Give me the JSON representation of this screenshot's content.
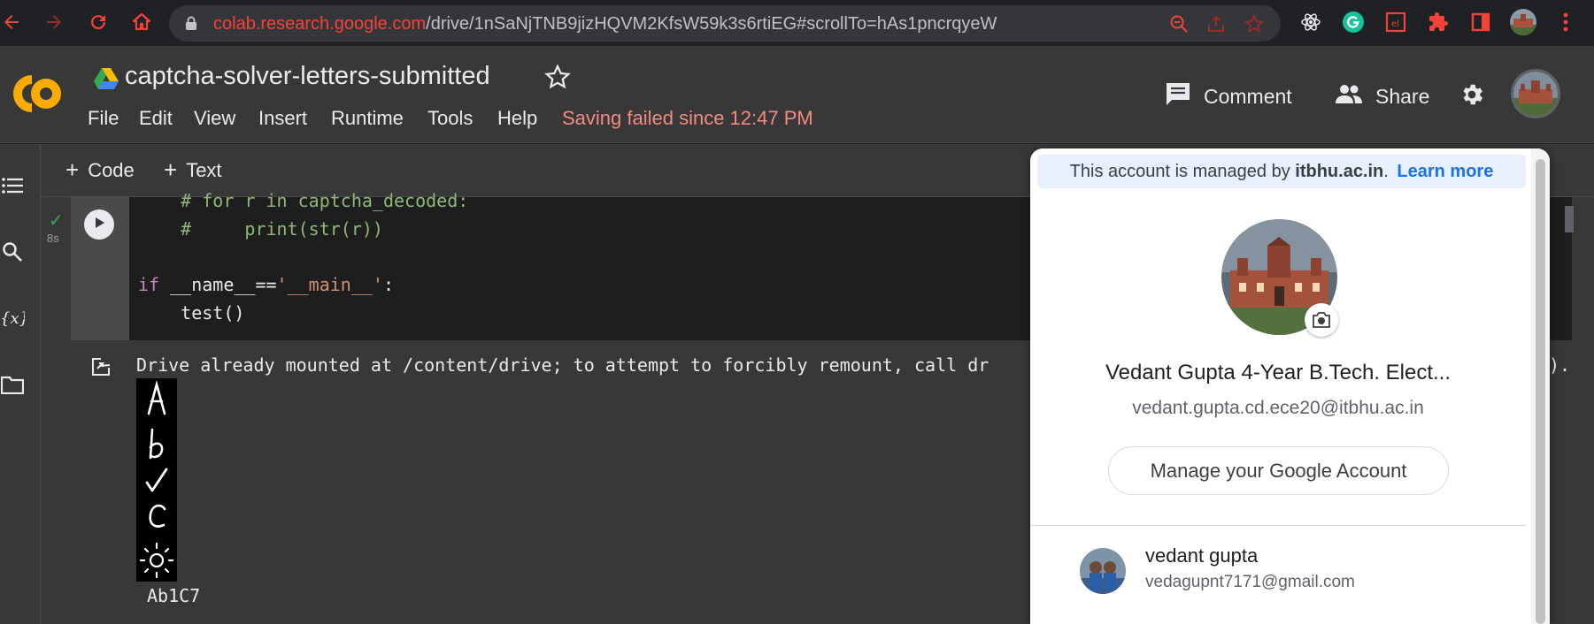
{
  "browser": {
    "url_host": "colab.research.google.com",
    "url_path": "/drive/1nSaNjTNB9jizHQVM2KfsW59k3s6rtiEG#scrollTo=hAs1pncrqyeW"
  },
  "header": {
    "title": "captcha-solver-letters-submitted",
    "menu": [
      "File",
      "Edit",
      "View",
      "Insert",
      "Runtime",
      "Tools",
      "Help"
    ],
    "saving_status": "Saving failed since 12:47 PM",
    "comment_label": "Comment",
    "share_label": "Share"
  },
  "toolbar": {
    "code_label": "Code",
    "text_label": "Text"
  },
  "cell": {
    "exec_time": "8s",
    "code_lines": [
      "    # for r in captcha_decoded:",
      "    #     print(str(r))",
      "",
      "if __name__=='__main__':",
      "    test()"
    ],
    "output_text": "Drive already mounted at /content/drive; to attempt to forcibly remount, call dr",
    "output_tail": ").",
    "captcha_label": "Ab1C7"
  },
  "account_popup": {
    "managed_prefix": "This account is managed by",
    "managed_domain": "itbhu.ac.in",
    "learn_more": "Learn more",
    "name": "Vedant Gupta 4-Year B.Tech. Elect...",
    "email": "vedant.gupta.cd.ece20@itbhu.ac.in",
    "manage_button": "Manage your Google Account",
    "other_account": {
      "name": "vedant gupta",
      "email": "vedagupnt7171@gmail.com"
    }
  },
  "colors": {
    "accent_orange": "#f9ab00",
    "error_red": "#f28b82",
    "link_blue": "#1a73e8"
  }
}
